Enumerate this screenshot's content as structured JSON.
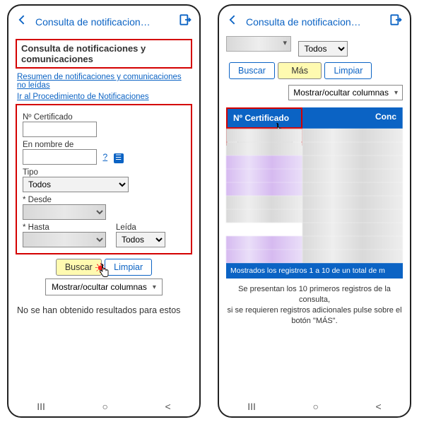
{
  "topbar": {
    "title_truncated": "Consulta de notificacion…"
  },
  "left": {
    "section_title": "Consulta de notificaciones y comunicaciones",
    "link_summary": "Resumen de notificaciones y comunicaciones no leídas",
    "link_proc": "Ir al Procedimiento de Notificaciones",
    "fields": {
      "cert_label": "Nº Certificado",
      "nombre_label": "En nombre de",
      "tipo_label": "Tipo",
      "tipo_value": "Todos",
      "desde_label": "* Desde",
      "hasta_label": "* Hasta",
      "leida_label": "Leída",
      "leida_value": "Todos"
    },
    "buttons": {
      "buscar": "Buscar",
      "limpiar": "Limpiar",
      "toggle_cols": "Mostrar/ocultar columnas"
    },
    "no_results": "No se han obtenido resultados para estos"
  },
  "right": {
    "top_selects": {
      "estado_value": "Todos"
    },
    "buttons": {
      "buscar": "Buscar",
      "mas": "Más",
      "limpiar": "Limpiar",
      "toggle_cols": "Mostrar/ocultar columnas"
    },
    "table": {
      "col_cert": "Nº Certificado",
      "col_conc": "Conc",
      "footer": "Mostrados los registros 1 a 10 de un total de m"
    },
    "summary_line1": "Se presentan los 10 primeros registros de la consulta,",
    "summary_line2": "si se requieren registros adicionales pulse sobre el botón \"MÁS\"."
  },
  "nav": {
    "recent": "III",
    "home": "○",
    "back": "<"
  }
}
